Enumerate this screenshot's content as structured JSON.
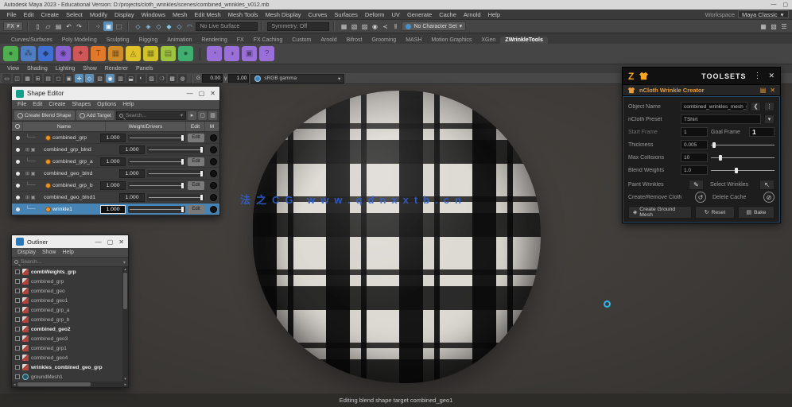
{
  "titlebar": {
    "title": "Autodesk Maya 2023 - Educational Version: D:/projects/cloth_wrinkles/scenes/combined_wrinkles_v012.mb",
    "minimize": "—",
    "maximize": "▢"
  },
  "win": {
    "min": "—",
    "max": "▢",
    "close": "✕"
  },
  "glyphs": {
    "caret": "▾",
    "kebab": "⋮",
    "close": "✕",
    "back": "❮"
  },
  "menubar": {
    "items": [
      "File",
      "Edit",
      "Create",
      "Select",
      "Modify",
      "Display",
      "Windows",
      "Mesh",
      "Edit Mesh",
      "Mesh Tools",
      "Mesh Display",
      "Curves",
      "Surfaces",
      "Deform",
      "UV",
      "Generate",
      "Cache",
      "Arnold",
      "Help"
    ],
    "workspace_label": "Workspace",
    "workspace_value": "Maya Classic"
  },
  "statusline": {
    "menuset": "FX",
    "file_icons": [
      {
        "glyph": "▯",
        "name": "new-scene-icon"
      },
      {
        "glyph": "▱",
        "name": "open-scene-icon"
      },
      {
        "glyph": "▤",
        "name": "save-scene-icon"
      },
      {
        "glyph": "↶",
        "name": "undo-icon"
      },
      {
        "glyph": "↷",
        "name": "redo-icon"
      }
    ],
    "select_icons": [
      {
        "glyph": "⁘",
        "name": "select-hierarchy-icon"
      },
      {
        "glyph": "▣",
        "name": "select-object-icon",
        "cls": "active"
      },
      {
        "glyph": "⬚",
        "name": "select-component-icon"
      }
    ],
    "snap_icons": [
      {
        "glyph": "◇",
        "name": "snap-grid-icon"
      },
      {
        "glyph": "◈",
        "name": "snap-curve-icon"
      },
      {
        "glyph": "◇",
        "name": "snap-point-icon"
      },
      {
        "glyph": "◆",
        "name": "snap-projected-center-icon"
      },
      {
        "glyph": "◇",
        "name": "snap-view-plane-icon"
      },
      {
        "glyph": "◠",
        "name": "make-live-icon"
      }
    ],
    "live_field": "No Live Surface",
    "sym_field": "Symmetry: Off",
    "render_icons": [
      {
        "glyph": "▦",
        "name": "render-icon"
      },
      {
        "glyph": "▧",
        "name": "ipr-render-icon"
      },
      {
        "glyph": "▨",
        "name": "render-settings-icon"
      },
      {
        "glyph": "◉",
        "name": "display-layer-icon"
      },
      {
        "glyph": "≺",
        "name": "node-editor-icon"
      },
      {
        "glyph": "‖",
        "name": "pause-icon"
      }
    ],
    "charset_value": "No Character Set",
    "right_icons": [
      {
        "glyph": "▦",
        "name": "modeling-toolkit-icon"
      },
      {
        "glyph": "▧",
        "name": "attribute-editor-icon"
      },
      {
        "glyph": "☰",
        "name": "channel-box-icon"
      }
    ]
  },
  "shelf": {
    "tabs": [
      {
        "label": "Curves/Surfaces"
      },
      {
        "label": "Poly Modeling"
      },
      {
        "label": "Sculpting"
      },
      {
        "label": "Rigging"
      },
      {
        "label": "Animation"
      },
      {
        "label": "Rendering"
      },
      {
        "label": "FX"
      },
      {
        "label": "FX Caching"
      },
      {
        "label": "Custom"
      },
      {
        "label": "Arnold"
      },
      {
        "label": "Bifrost"
      },
      {
        "label": "Grooming"
      },
      {
        "label": "MASH"
      },
      {
        "label": "Motion Graphics"
      },
      {
        "label": "XGen"
      },
      {
        "label": "ZWrinkleTools",
        "cls": "active"
      }
    ],
    "icons": [
      {
        "glyph": "●",
        "bg": "#4fae4f",
        "name": "sphere-shelf-icon"
      },
      {
        "glyph": "⁂",
        "bg": "#4f7dbf",
        "name": "particles-shelf-icon"
      },
      {
        "glyph": "◆",
        "bg": "#3f6fd0",
        "name": "crystal-shelf-icon"
      },
      {
        "glyph": "◉",
        "bg": "#8a5fd0",
        "name": "nucleus-shelf-icon"
      },
      {
        "glyph": "✦",
        "bg": "#d05757",
        "name": "pin-shelf-icon"
      },
      {
        "glyph": "T",
        "bg": "#e07a2a",
        "name": "text-shelf-icon"
      },
      {
        "glyph": "▦",
        "bg": "#d08a2a",
        "name": "lattice-shelf-icon"
      },
      {
        "glyph": "◬",
        "bg": "#e0c22a",
        "name": "emitter-shelf-icon"
      },
      {
        "glyph": "▦",
        "bg": "#d0c22a",
        "name": "checker-shelf-icon"
      },
      {
        "glyph": "▤",
        "bg": "#9ec43f",
        "name": "cache-shelf-icon"
      },
      {
        "glyph": "●",
        "bg": "#3fae6f",
        "name": "field-shelf-icon"
      }
    ],
    "icons2": [
      {
        "glyph": "◔",
        "bg": "#9a6fd8",
        "name": "ncloth-create-icon"
      },
      {
        "glyph": "◑",
        "bg": "#9a6fd8",
        "name": "ncloth-collider-icon"
      },
      {
        "glyph": "▣",
        "bg": "#9a6fd8",
        "name": "ncache-icon"
      },
      {
        "glyph": "?",
        "bg": "#9a6fd8",
        "name": "help-shelf-icon"
      }
    ]
  },
  "viewport": {
    "menus": [
      "View",
      "Shading",
      "Lighting",
      "Show",
      "Renderer",
      "Panels"
    ],
    "toolbar_icons": [
      {
        "glyph": "▭",
        "name": "select-camera-icon"
      },
      {
        "glyph": "◫",
        "name": "lock-camera-icon"
      },
      {
        "glyph": "▦",
        "name": "camera-attributes-icon"
      },
      {
        "glyph": "⊞",
        "name": "bookmarks-icon"
      },
      {
        "glyph": "▤",
        "name": "image-plane-icon"
      },
      {
        "glyph": "◻",
        "name": "2d-pan-zoom-icon"
      },
      {
        "glyph": "▣",
        "name": "grease-pencil-icon"
      },
      {
        "glyph": "✛",
        "name": "grid-icon",
        "cls": "active"
      },
      {
        "glyph": "◇",
        "name": "film-gate-icon",
        "cls": "active"
      },
      {
        "glyph": "▧",
        "name": "resolution-gate-icon"
      },
      {
        "glyph": "◉",
        "name": "gate-mask-icon",
        "cls": "active"
      },
      {
        "glyph": "▥",
        "name": "field-chart-icon"
      },
      {
        "glyph": "⬓",
        "name": "safe-action-icon"
      },
      {
        "glyph": "◐",
        "name": "safe-title-icon"
      },
      {
        "glyph": "▨",
        "name": "wireframe-icon"
      },
      {
        "glyph": "❍",
        "name": "shaded-icon"
      },
      {
        "glyph": "▩",
        "name": "textured-icon"
      },
      {
        "glyph": "◍",
        "name": "lights-icon"
      }
    ],
    "exposure_label": "G",
    "exposure": "0.00",
    "gamma_label": "γ",
    "gamma": "1.00",
    "colorspace": "sRGB gamma",
    "watermark": "法之CG www.qdnxxtb.cn"
  },
  "helpline": {
    "text": "Editing blend shape target combined_geo1"
  },
  "shape_editor": {
    "title": "Shape Editor",
    "menus": [
      "File",
      "Edit",
      "Create",
      "Shapes",
      "Options",
      "Help"
    ],
    "create_btn": "Create Blend Shape",
    "add_btn": "Add Target",
    "search_placeholder": "Search...",
    "tool_icons": [
      {
        "glyph": "▸",
        "name": "filter-icon"
      },
      {
        "glyph": "▢",
        "name": "pin-icon"
      },
      {
        "glyph": "▥",
        "name": "options-icon"
      }
    ],
    "headers": {
      "name": "Name",
      "weight": "Weight/Drivers",
      "edit": "Edit",
      "mute": "M"
    },
    "rows": [
      {
        "tree": "└──",
        "isTarget": true,
        "name": "combined_grp",
        "value": "1.000",
        "pct": "93%",
        "edit": "Edit"
      },
      {
        "tree": "⊞ ▣",
        "isTarget": false,
        "name": "combined_grp_blnd",
        "value": "1.000",
        "pct": "93%"
      },
      {
        "tree": "└──",
        "isTarget": true,
        "name": "combined_grp_a",
        "value": "1.000",
        "pct": "93%",
        "edit": "Edit"
      },
      {
        "tree": "⊞ ▣",
        "isTarget": false,
        "name": "combined_geo_blnd",
        "value": "1.000",
        "pct": "93%"
      },
      {
        "tree": "└──",
        "isTarget": true,
        "name": "combined_grp_b",
        "value": "1.000",
        "pct": "93%",
        "edit": "Edit"
      },
      {
        "tree": "⊞ ▣",
        "isTarget": false,
        "name": "combined_geo_blnd1",
        "value": "1.000",
        "pct": "93%"
      },
      {
        "cls": "sel",
        "tree": "└──",
        "isTarget": true,
        "name": "wrinkle1",
        "value": "1.000",
        "pct": "93%",
        "edit": "Edit"
      }
    ]
  },
  "outliner": {
    "title": "Outliner",
    "menus": [
      "Display",
      "Show",
      "Help"
    ],
    "search_placeholder": "Search...",
    "items": [
      {
        "name": "combWeights_grp",
        "cls": "bold",
        "isMesh": true
      },
      {
        "name": "combined_grp",
        "isMesh": true
      },
      {
        "name": "combined_geo",
        "isMesh": true
      },
      {
        "name": "combined_geo1",
        "isMesh": true
      },
      {
        "name": "combined_grp_a",
        "isMesh": true
      },
      {
        "name": "combined_grp_b",
        "isMesh": true
      },
      {
        "name": "combined_geo2",
        "cls": "bold",
        "isMesh": true
      },
      {
        "name": "combined_geo3",
        "isMesh": true
      },
      {
        "name": "combined_grp1",
        "isMesh": true
      },
      {
        "name": "combined_geo4",
        "isMesh": true
      },
      {
        "name": "wrinkles_combined_geo_grp",
        "cls": "bold",
        "isMesh": true
      },
      {
        "name": "groundMesh1",
        "isBall": true
      }
    ]
  },
  "toolsets": {
    "logo": "Z",
    "title": "TOOLSETS",
    "panel_title": "nCloth Wrinkle Creator",
    "object_name_label": "Object Name",
    "object_name_value": "combined_wrinkles_mesh_geo",
    "preset_label": "nCloth Preset",
    "preset_value": "TShirt",
    "start_label": "Start Frame",
    "start_value": "1",
    "goal_label": "Goal Frame",
    "goal_value": "1",
    "thickness_label": "Thickness",
    "thickness_value": "0.005",
    "collisions_label": "Max Collisions",
    "collisions_value": "10",
    "blend_label": "Blend Weights",
    "blend_value": "1.0",
    "paint_label": "Paint Wrinkles",
    "paint_icon": "✎",
    "select_label": "Select Wrinkles",
    "select_icon": "↖",
    "create_cloth_label": "Create/Remove Cloth",
    "create_cloth_icon": "↺",
    "delete_cache_label": "Delete Cache",
    "delete_cache_icon": "⊘",
    "ground_btn": "Create Ground Mesh",
    "ground_icon": "◈",
    "reset_btn": "Reset",
    "reset_icon": "↻",
    "bake_btn": "Bake",
    "bake_icon": "▤",
    "accent": "#e89c3c",
    "border": "#2a4a66"
  }
}
